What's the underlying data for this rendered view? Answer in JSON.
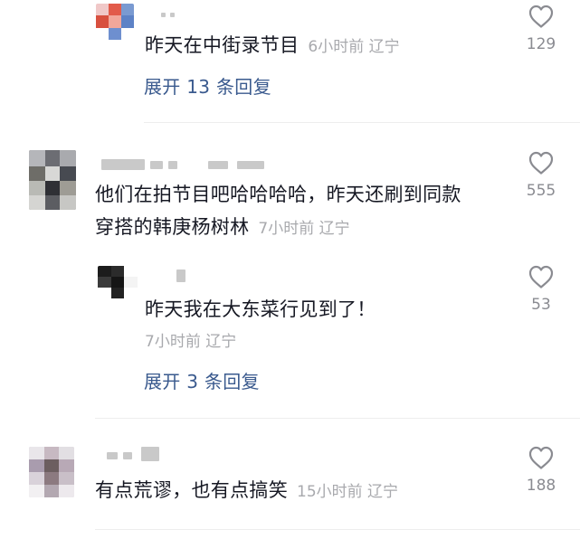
{
  "comments": [
    {
      "text": "昨天在中街录节目",
      "time": "6小时前",
      "location": "辽宁",
      "likes": "129",
      "expand_label": "展开 13 条回复"
    },
    {
      "text_line1": "他们在拍节目吧哈哈哈哈，昨天还刷到同款",
      "text_line2": "穿搭的韩庚杨树林",
      "time": "7小时前",
      "location": "辽宁",
      "likes": "555",
      "reply": {
        "text": "昨天我在大东菜行见到了！",
        "time": "7小时前",
        "location": "辽宁",
        "likes": "53"
      },
      "expand_label": "展开 3 条回复"
    },
    {
      "text": "有点荒谬，也有点搞笑",
      "time": "15小时前",
      "location": "辽宁",
      "likes": "188"
    }
  ],
  "icons": {
    "like": "heart-outline-icon"
  },
  "colors": {
    "text": "#161823",
    "meta": "#a8a9ad",
    "link": "#3a5a8e",
    "count": "#8a8b91"
  }
}
